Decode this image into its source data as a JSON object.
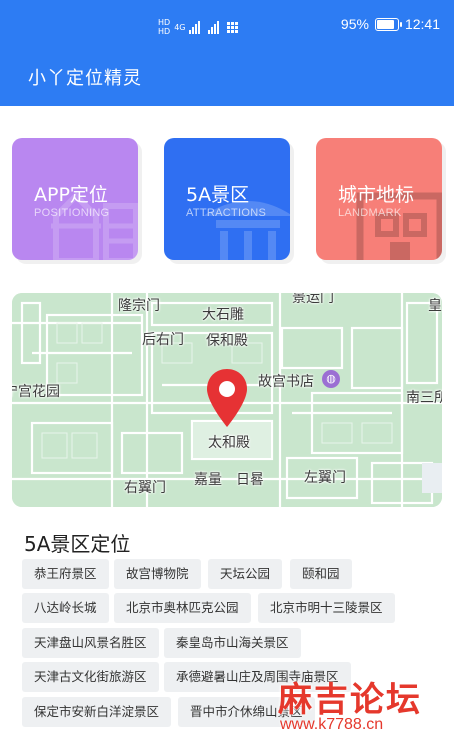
{
  "status": {
    "battery": "95%",
    "time": "12:41",
    "battery_level": 0.95,
    "network": "4G"
  },
  "app": {
    "title": "小丫定位精灵"
  },
  "cards": [
    {
      "title": "APP定位",
      "subtitle": "POSITIONING",
      "color": "#b987f0"
    },
    {
      "title": "5A景区",
      "subtitle": "ATTRACTIONS",
      "color": "#2f6ff2"
    },
    {
      "title": "城市地标",
      "subtitle": "LANDMARK",
      "color": "#f77f78"
    }
  ],
  "map": {
    "labels": [
      "隆宗门",
      "大石雕",
      "景运门",
      "皇",
      "保和殿",
      "后右门",
      "宁宫花园",
      "故宫书店",
      "南三所",
      "太和殿",
      "右翼门",
      "嘉量",
      "日晷",
      "左翼门"
    ],
    "pin_color": "#e63234"
  },
  "section": {
    "title": "5A景区定位",
    "tags": [
      "恭王府景区",
      "故宫博物院",
      "天坛公园",
      "颐和园",
      "八达岭长城",
      "北京市奥林匹克公园",
      "北京市明十三陵景区",
      "天津盘山风景名胜区",
      "秦皇岛市山海关景区",
      "天津古文化街旅游区",
      "承德避暑山庄及周围寺庙景区",
      "保定市安新白洋淀景区",
      "晋中市介休绵山景区"
    ]
  },
  "watermark": {
    "main": "麻吉论坛",
    "url": "www.k7788.cn"
  }
}
